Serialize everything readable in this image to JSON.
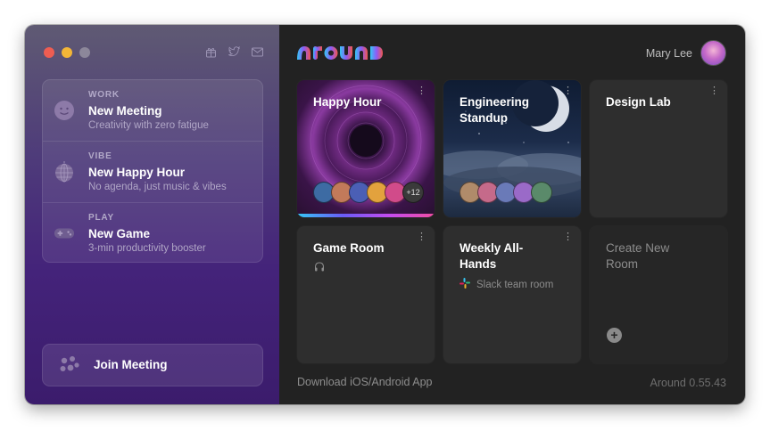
{
  "sidebar": {
    "top_icons": [
      "gift-icon",
      "twitter-icon",
      "mail-icon"
    ],
    "items": [
      {
        "category": "WORK",
        "title": "New Meeting",
        "subtitle": "Creativity with zero fatigue",
        "icon": "smiley-icon"
      },
      {
        "category": "VIBE",
        "title": "New Happy Hour",
        "subtitle": "No agenda, just music & vibes",
        "icon": "disco-ball-icon"
      },
      {
        "category": "PLAY",
        "title": "New Game",
        "subtitle": "3-min productivity booster",
        "icon": "gamepad-icon"
      }
    ],
    "join_label": "Join Meeting"
  },
  "header": {
    "logo": "around",
    "user_name": "Mary Lee"
  },
  "rooms": [
    {
      "title": "Happy Hour",
      "extra_count": "+12"
    },
    {
      "title": "Engineering Standup"
    },
    {
      "title": "Design Lab"
    },
    {
      "title": "Game Room"
    },
    {
      "title": "Weekly All-Hands",
      "subtitle": "Slack team room"
    },
    {
      "title": "Create New Room"
    }
  ],
  "footer": {
    "download": "Download iOS/Android App",
    "version": "Around 0.55.43"
  },
  "colors": {
    "accent_gradient_start": "#35c7f5",
    "accent_gradient_end": "#f04da2",
    "main_bg": "#222222",
    "tile_bg": "#2e2e2e"
  }
}
